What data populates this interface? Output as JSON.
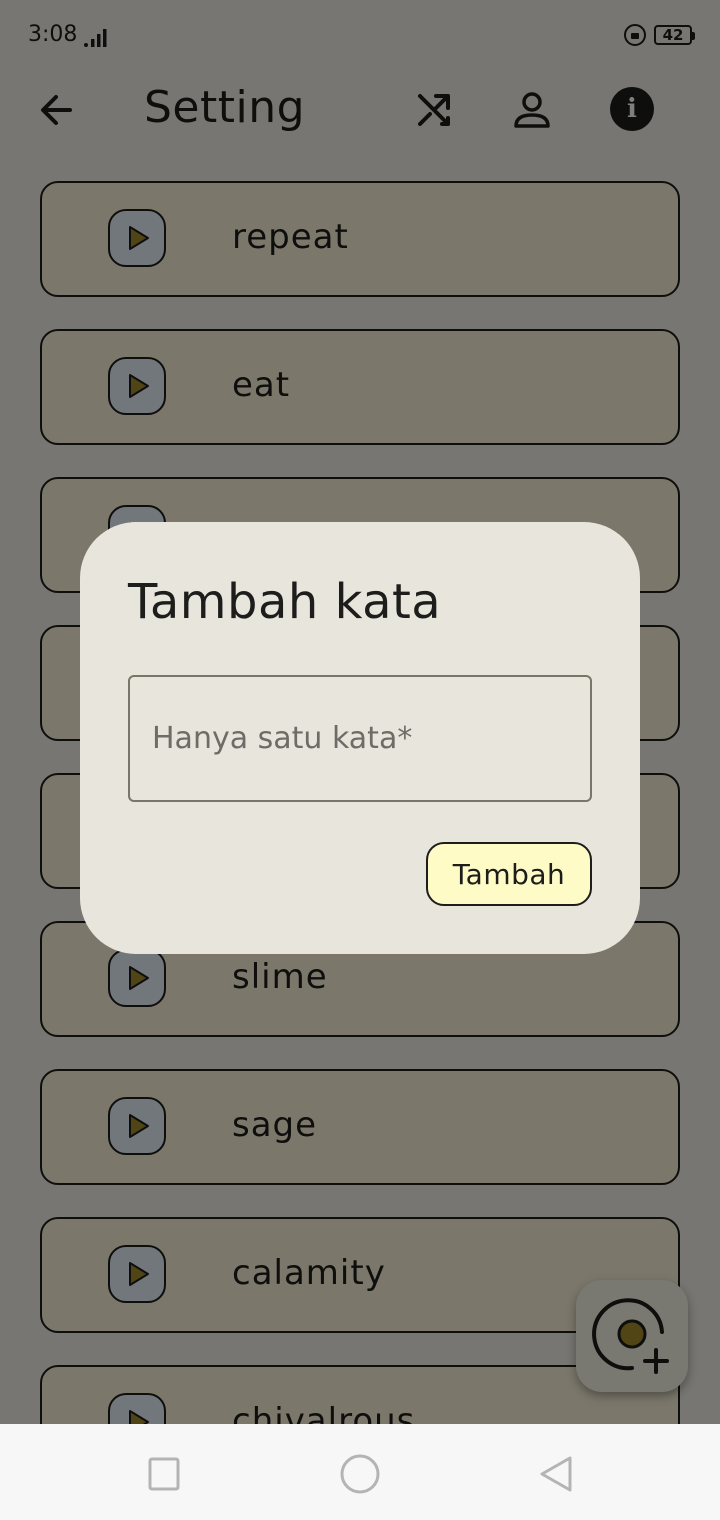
{
  "status_bar": {
    "time": "3:08",
    "battery": "42"
  },
  "app_bar": {
    "title": "Setting",
    "icons": [
      "arrow-left-icon",
      "shuffle-icon",
      "user-icon",
      "info-icon"
    ],
    "info_glyph": "i"
  },
  "words": [
    {
      "label": "repeat"
    },
    {
      "label": "eat"
    },
    {
      "label": ""
    },
    {
      "label": ""
    },
    {
      "label": ""
    },
    {
      "label": "slime"
    },
    {
      "label": "sage"
    },
    {
      "label": "calamity"
    },
    {
      "label": "chivalrous"
    }
  ],
  "dialog": {
    "title": "Tambah kata",
    "input_placeholder": "Hanya satu kata*",
    "input_value": "",
    "submit_label": "Tambah"
  },
  "fab": {
    "icon": "add-record-icon"
  },
  "nav": {
    "icons": [
      "recents-square-icon",
      "home-circle-icon",
      "back-triangle-icon"
    ]
  },
  "colors": {
    "card_bg": "#f6f0d6",
    "play_bg": "#e4eef8",
    "play_arrow": "#a28a2b",
    "dialog_bg": "#e8e5dd",
    "button_bg": "#fffbc6",
    "text": "#1d1d1b"
  }
}
